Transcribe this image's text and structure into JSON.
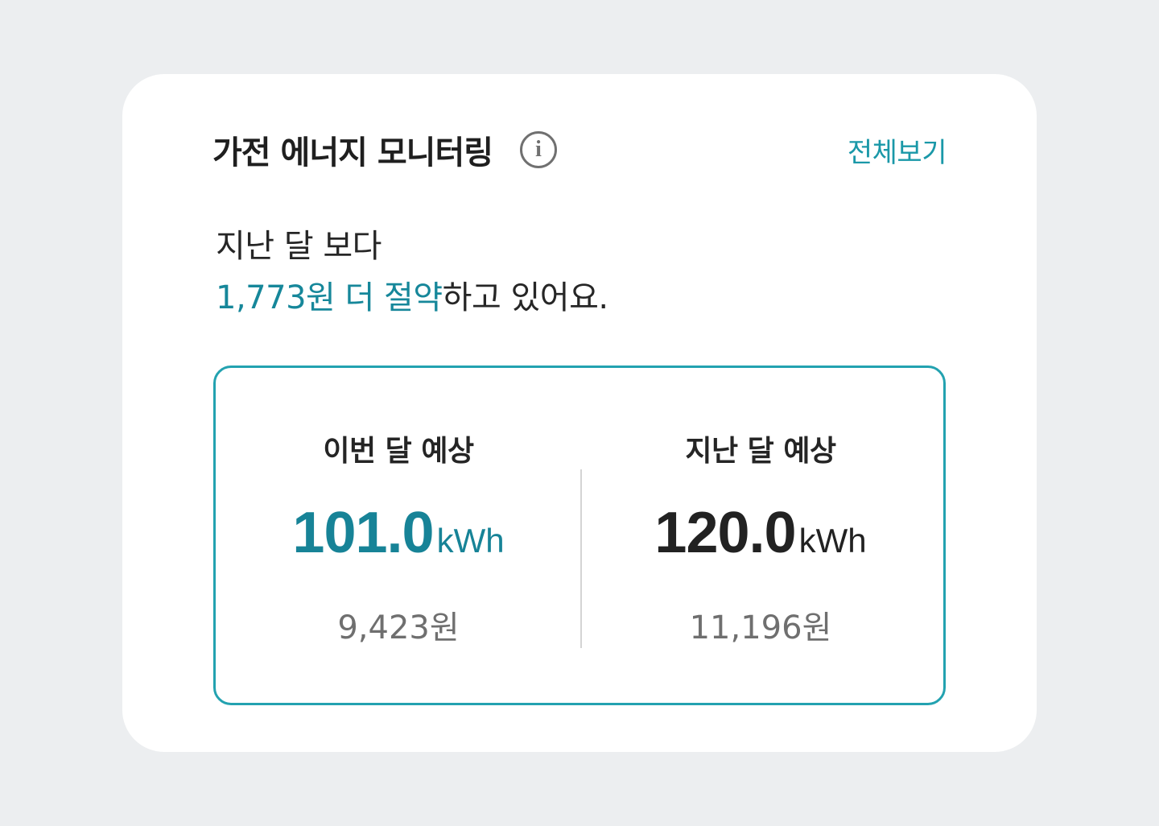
{
  "header": {
    "title": "가전 에너지 모니터링",
    "info_icon": "info-icon",
    "view_all_label": "전체보기"
  },
  "summary": {
    "line1": "지난 달 보다",
    "highlight": "1,773원 더 절약",
    "line2_rest": "하고 있어요."
  },
  "comparison": {
    "this_month": {
      "label": "이번 달 예상",
      "value": "101.0",
      "unit": "kWh",
      "cost": "9,423원"
    },
    "last_month": {
      "label": "지난 달 예상",
      "value": "120.0",
      "unit": "kWh",
      "cost": "11,196원"
    }
  },
  "colors": {
    "accent": "#16879a",
    "link": "#1a98a8",
    "border": "#23a2b0",
    "background": "#eceef0",
    "card": "#ffffff"
  }
}
